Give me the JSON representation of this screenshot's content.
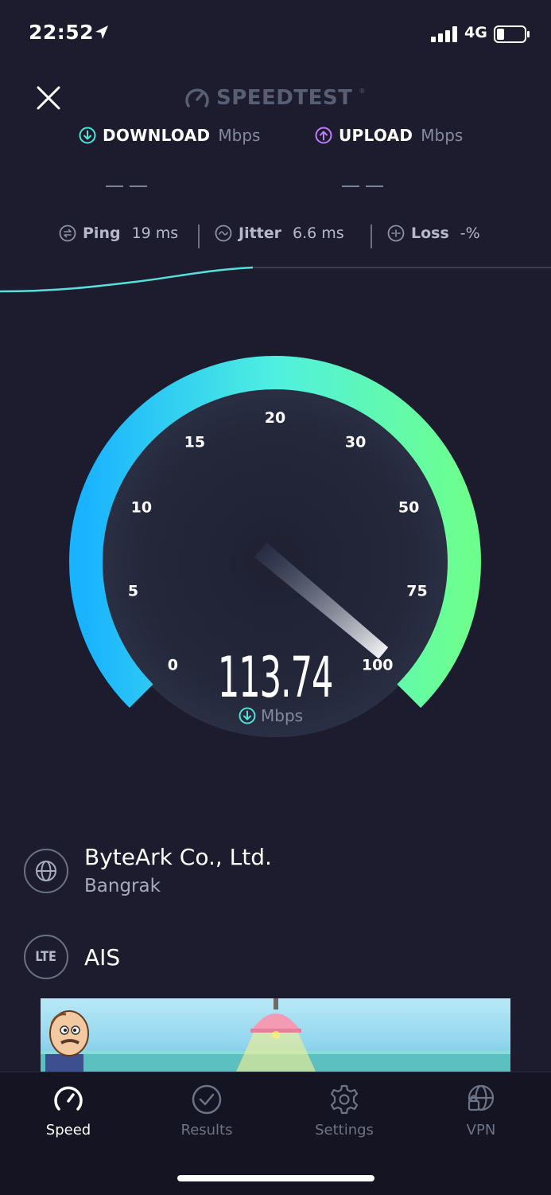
{
  "status_bar": {
    "time": "22:52",
    "network": "4G",
    "icons": [
      "location-arrow-icon",
      "cellular-signal-icon",
      "battery-icon"
    ]
  },
  "header": {
    "brand": "SPEEDTEST",
    "trademark": "®",
    "close_icon": "close-icon"
  },
  "download": {
    "label": "DOWNLOAD",
    "unit": "Mbps",
    "value": "— —",
    "accent": "#4ee3d4"
  },
  "upload": {
    "label": "UPLOAD",
    "unit": "Mbps",
    "value": "— —",
    "accent": "#c07bff"
  },
  "stats": {
    "ping": {
      "label": "Ping",
      "value": "19 ms"
    },
    "jitter": {
      "label": "Jitter",
      "value": "6.6 ms"
    },
    "loss": {
      "label": "Loss",
      "value": "-%"
    }
  },
  "gauge": {
    "ticks": [
      "0",
      "5",
      "10",
      "15",
      "20",
      "30",
      "50",
      "75",
      "100"
    ],
    "current_value": "113.74",
    "unit": "Mbps",
    "gradient_start": "#1ab3ff",
    "gradient_mid": "#4ff0e0",
    "gradient_end": "#6dff8e"
  },
  "server": {
    "name": "ByteArk Co., Ltd.",
    "location": "Bangrak",
    "icon": "globe-icon"
  },
  "carrier": {
    "badge": "LTE",
    "name": "AIS"
  },
  "tabs": [
    {
      "label": "Speed",
      "icon": "speedometer-icon",
      "active": true
    },
    {
      "label": "Results",
      "icon": "check-circle-icon",
      "active": false
    },
    {
      "label": "Settings",
      "icon": "gear-icon",
      "active": false
    },
    {
      "label": "VPN",
      "icon": "globe-lock-icon",
      "active": false
    }
  ]
}
